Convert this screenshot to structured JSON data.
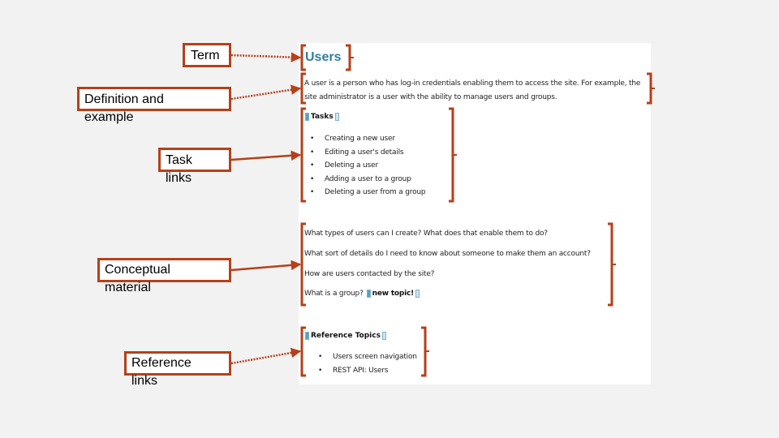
{
  "colors": {
    "accent": "#b5401a",
    "title": "#2e7f9e",
    "background": "#f2f2f2",
    "document": "#ffffff"
  },
  "labels": {
    "term": "Term",
    "definition": "Definition and\nexample",
    "tasks": "Task\nlinks",
    "conceptual": "Conceptual\nmaterial",
    "reference": "Reference\nlinks"
  },
  "document": {
    "title": "Users",
    "definition_line1": "A user is a person who has log-in credentials enabling them to access the site. For example, the",
    "definition_line2": "site administrator is a user with the ability to manage users and groups.",
    "tasks_heading": "Tasks",
    "tasks": [
      "Creating a new user",
      "Editing a user's details",
      "Deleting a user",
      "Adding a user to a group",
      "Deleting a user from a group"
    ],
    "concepts": [
      "What types of users can I create? What does that enable them to do?",
      "What sort of details do I need to know about someone to make them an account?",
      "How are users contacted by the site?",
      "What is a group?"
    ],
    "new_topic": "new topic!",
    "reference_heading": "Reference Topics",
    "references": [
      "Users screen navigation",
      "REST API: Users"
    ]
  }
}
